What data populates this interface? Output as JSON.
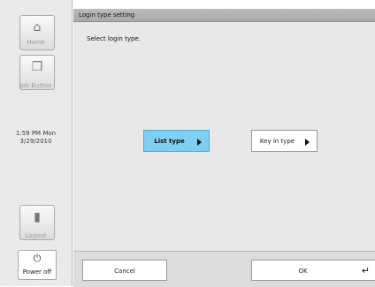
{
  "sidebar": {
    "home_label": "Home",
    "home_icon": "home-icon",
    "job_label": "Job Button",
    "job_icon": "job-button-icon",
    "clock_time": "1:59 PM  Mon",
    "clock_date": "3/29/2010",
    "logout_label": "Logout",
    "logout_icon": "logout-icon",
    "power_label": "Power off",
    "power_icon": "power-icon"
  },
  "header": {
    "title": "Login type setting"
  },
  "main": {
    "instruction": "Select login type.",
    "options": [
      {
        "label": "List type",
        "selected": true
      },
      {
        "label": "Key in type",
        "selected": false
      }
    ]
  },
  "footer": {
    "cancel_label": "Cancel",
    "ok_label": "OK",
    "ok_icon": "enter-icon"
  },
  "colors": {
    "selected_button": "#7ecff1",
    "title_bar": "#b3b3b3",
    "content_background": "#e8e8e8"
  }
}
